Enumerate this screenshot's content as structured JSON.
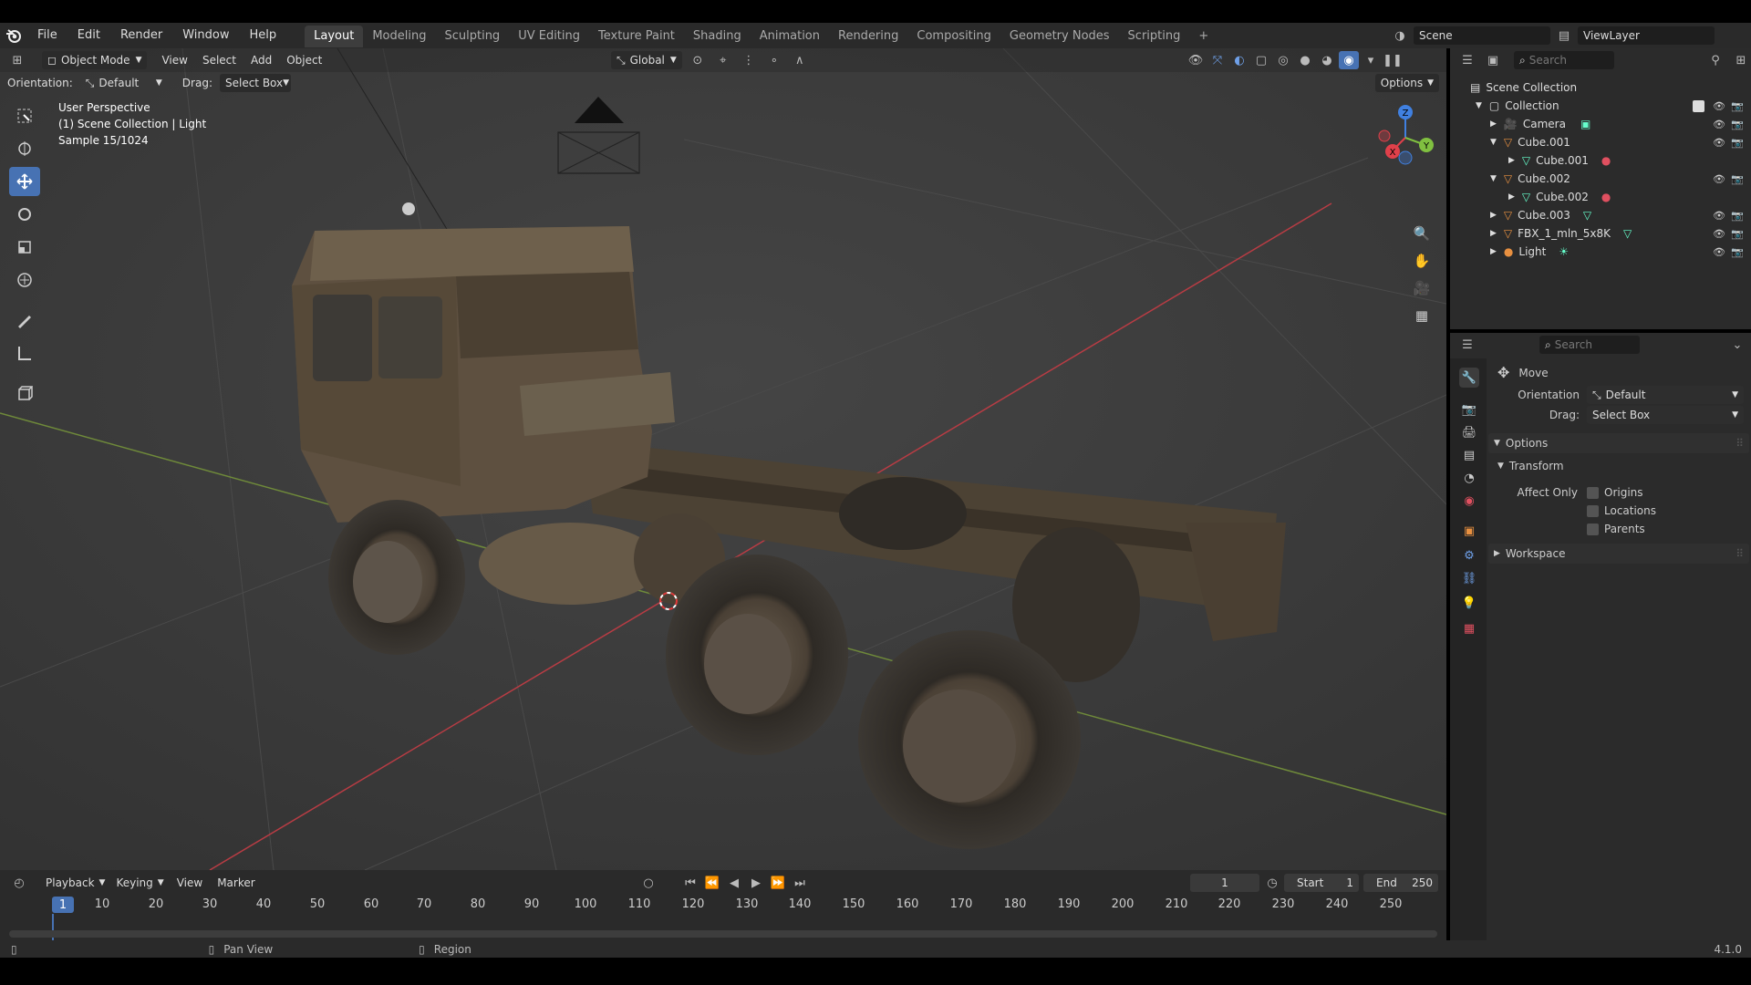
{
  "topbar": {
    "menus": [
      "File",
      "Edit",
      "Render",
      "Window",
      "Help"
    ],
    "workspaces": [
      "Layout",
      "Modeling",
      "Sculpting",
      "UV Editing",
      "Texture Paint",
      "Shading",
      "Animation",
      "Rendering",
      "Compositing",
      "Geometry Nodes",
      "Scripting"
    ],
    "add_tab": "+",
    "scene": "Scene",
    "view_layer": "ViewLayer"
  },
  "viewport": {
    "mode": "Object Mode",
    "menus": [
      "View",
      "Select",
      "Add",
      "Object"
    ],
    "transform_orientation": "Global",
    "orientation_label": "Orientation:",
    "orientation_value": "Default",
    "drag_label": "Drag:",
    "drag_value": "Select Box",
    "options": "Options",
    "info_line1": "User Perspective",
    "info_line2": "(1) Scene Collection | Light",
    "info_line3": "Sample 15/1024",
    "gizmo_axes": [
      "Z",
      "X",
      "Y"
    ]
  },
  "timeline": {
    "menus": [
      "Playback",
      "Keying",
      "View",
      "Marker"
    ],
    "current_frame": "1",
    "start_label": "Start",
    "start_value": "1",
    "end_label": "End",
    "end_value": "250",
    "ruler": [
      "10",
      "20",
      "30",
      "40",
      "50",
      "60",
      "70",
      "80",
      "90",
      "100",
      "110",
      "120",
      "130",
      "140",
      "150",
      "160",
      "170",
      "180",
      "190",
      "200",
      "210",
      "220",
      "230",
      "240",
      "250"
    ],
    "playhead": "1"
  },
  "statusbar": {
    "pan_view": "Pan View",
    "region": "Region",
    "version": "4.1.0"
  },
  "outliner": {
    "search_placeholder": "Search",
    "scene_collection": "Scene Collection",
    "collection": "Collection",
    "items": [
      "Camera",
      "Cube.001",
      "Cube.001",
      "Cube.002",
      "Cube.002",
      "Cube.003",
      "FBX_1_mln_5x8K",
      "Light"
    ]
  },
  "properties": {
    "search_placeholder": "Search",
    "tool_name": "Move",
    "orientation_label": "Orientation",
    "orientation_value": "Default",
    "drag_label": "Drag:",
    "drag_value": "Select Box",
    "options_panel": "Options",
    "transform_panel": "Transform",
    "affect_only": "Affect Only",
    "origins": "Origins",
    "locations": "Locations",
    "parents": "Parents",
    "workspace_panel": "Workspace"
  },
  "colors": {
    "accent": "#4772b3",
    "x_axis": "#e0404a",
    "y_axis": "#80c040",
    "z_axis": "#4080e0",
    "object_orange": "#e89040"
  }
}
